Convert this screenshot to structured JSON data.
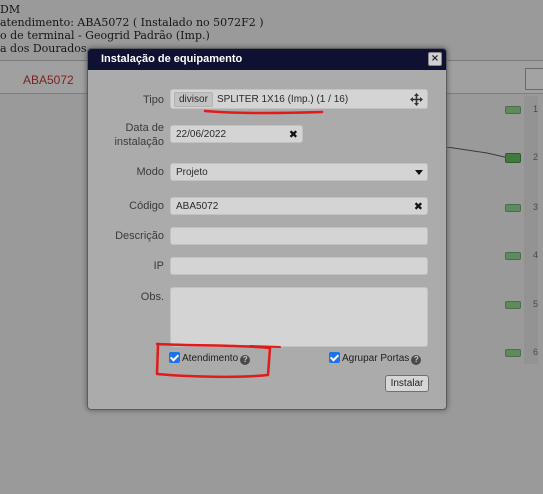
{
  "background": {
    "lines": [
      "DM",
      "atendimento: ABA5072 ( Instalado no 5072F2 )",
      "o de terminal - Geogrid Padrão (Imp.)",
      "a dos Dourados"
    ],
    "tab_code": "ABA5072",
    "ports": [
      "1",
      "2",
      "3",
      "4",
      "5",
      "6"
    ]
  },
  "dialog": {
    "title": "Instalação de equipamento",
    "close_label": "×",
    "tipo": {
      "label": "Tipo",
      "badge": "divisor",
      "value": "SPLITER 1X16 (Imp.) (1 / 16)",
      "icon": "move-icon"
    },
    "data_instalacao": {
      "label_line1": "Data de",
      "label_line2": "instalação",
      "value": "22/06/2022",
      "clear": "✖"
    },
    "modo": {
      "label": "Modo",
      "value": "Projeto",
      "icon": "chevron-down-icon"
    },
    "codigo": {
      "label": "Código",
      "value": "ABA5072",
      "clear": "✖"
    },
    "descricao": {
      "label": "Descrição",
      "value": ""
    },
    "ip": {
      "label": "IP",
      "value": ""
    },
    "obs": {
      "label": "Obs.",
      "value": ""
    },
    "atendimento": {
      "label": "Atendimento",
      "checked": true,
      "help": "?"
    },
    "agrupar_portas": {
      "label": "Agrupar Portas",
      "checked": true,
      "help": "?"
    },
    "install_button": "Instalar"
  },
  "colors": {
    "title_bar": "#0f1133",
    "annotation": "#e01b1b",
    "checkbox": "#1a73e8",
    "port_green": "#3f7a3f"
  }
}
